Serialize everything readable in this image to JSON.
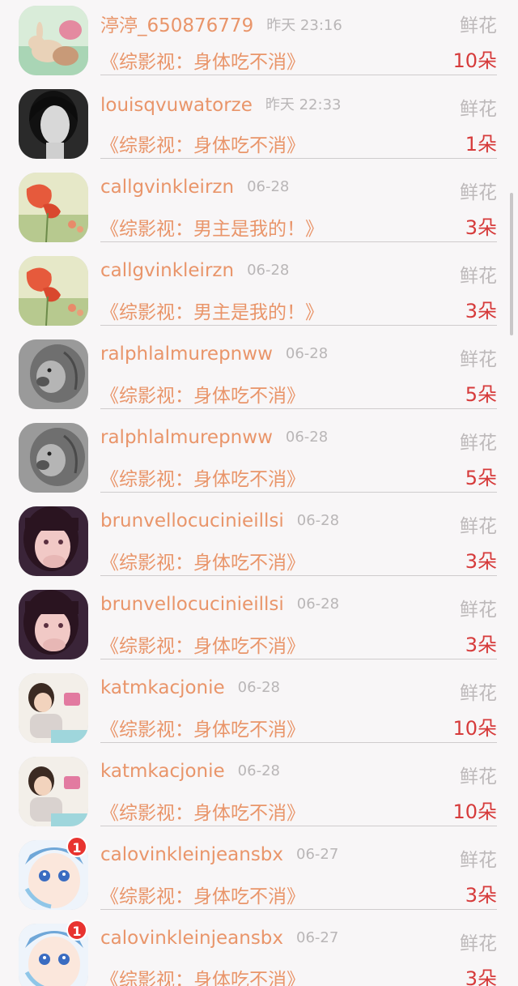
{
  "gift_list": {
    "items": [
      {
        "name": "渟渟_650876779",
        "time": "昨天 23:16",
        "gift": "鲜花",
        "work": "《综影视：身体吃不消》",
        "count": "10朵",
        "avatar_icon": "bunny-avatar"
      },
      {
        "name": "louisqvuwatorze",
        "time": "昨天 22:33",
        "gift": "鲜花",
        "work": "《综影视：身体吃不消》",
        "count": "1朵",
        "avatar_icon": "woman-portrait-avatar"
      },
      {
        "name": "callgvinkleirzn",
        "time": "06-28",
        "gift": "鲜花",
        "work": "《综影视：男主是我的！》",
        "count": "3朵",
        "avatar_icon": "poppy-flower-avatar"
      },
      {
        "name": "callgvinkleirzn",
        "time": "06-28",
        "gift": "鲜花",
        "work": "《综影视：男主是我的！》",
        "count": "3朵",
        "avatar_icon": "poppy-flower-avatar"
      },
      {
        "name": "ralphlalmurepnww",
        "time": "06-28",
        "gift": "鲜花",
        "work": "《综影视：身体吃不消》",
        "count": "5朵",
        "avatar_icon": "lion-sketch-avatar"
      },
      {
        "name": "ralphlalmurepnww",
        "time": "06-28",
        "gift": "鲜花",
        "work": "《综影视：身体吃不消》",
        "count": "5朵",
        "avatar_icon": "lion-sketch-avatar"
      },
      {
        "name": "brunvellocucinieillsi",
        "time": "06-28",
        "gift": "鲜花",
        "work": "《综影视：身体吃不消》",
        "count": "3朵",
        "avatar_icon": "girl-selfie-avatar"
      },
      {
        "name": "brunvellocucinieillsi",
        "time": "06-28",
        "gift": "鲜花",
        "work": "《综影视：身体吃不消》",
        "count": "3朵",
        "avatar_icon": "girl-selfie-avatar"
      },
      {
        "name": "katmkacjonie",
        "time": "06-28",
        "gift": "鲜花",
        "work": "《综影视：身体吃不消》",
        "count": "10朵",
        "avatar_icon": "child-photo-avatar"
      },
      {
        "name": "katmkacjonie",
        "time": "06-28",
        "gift": "鲜花",
        "work": "《综影视：身体吃不消》",
        "count": "10朵",
        "avatar_icon": "child-photo-avatar"
      },
      {
        "name": "calovinkleinjeansbx",
        "time": "06-27",
        "gift": "鲜花",
        "work": "《综影视：身体吃不消》",
        "count": "3朵",
        "avatar_icon": "anime-face-avatar",
        "badge": "1"
      },
      {
        "name": "calovinkleinjeansbx",
        "time": "06-27",
        "gift": "鲜花",
        "work": "《综影视：身体吃不消》",
        "count": "3朵",
        "avatar_icon": "anime-face-avatar",
        "badge": "1"
      }
    ]
  }
}
